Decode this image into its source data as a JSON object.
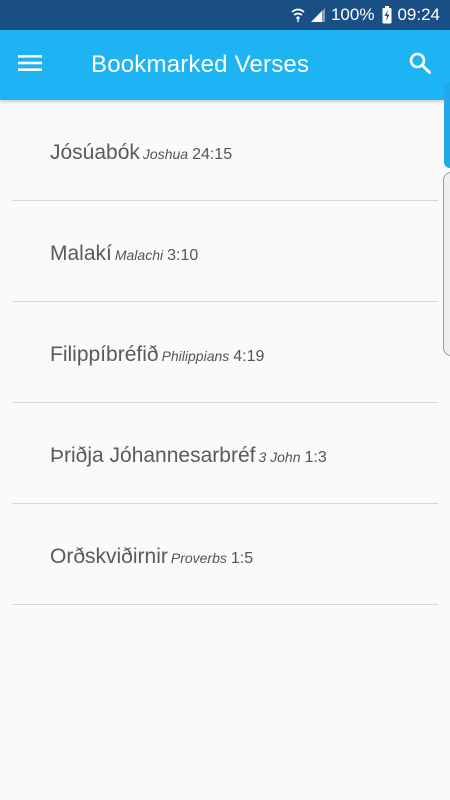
{
  "status_bar": {
    "battery": "100%",
    "time": "09:24"
  },
  "app_bar": {
    "title": "Bookmarked Verses",
    "menu_icon": "hamburger-menu-icon",
    "search_icon": "search-icon"
  },
  "bookmarks": [
    {
      "book_is": "Jósúabók",
      "book_en": "Joshua",
      "ref": "24:15"
    },
    {
      "book_is": "Malakí",
      "book_en": "Malachi",
      "ref": "3:10"
    },
    {
      "book_is": "Filippíbréfið",
      "book_en": "Philippians",
      "ref": "4:19"
    },
    {
      "book_is": "Þriðja Jóhannesarbréf",
      "book_en": "3 John",
      "ref": "1:3"
    },
    {
      "book_is": "Orðskviðirnir",
      "book_en": "Proverbs",
      "ref": "1:5"
    }
  ],
  "colors": {
    "status_bar": "#1a4f86",
    "app_bar": "#1eb4f4",
    "background": "#fafafa"
  }
}
